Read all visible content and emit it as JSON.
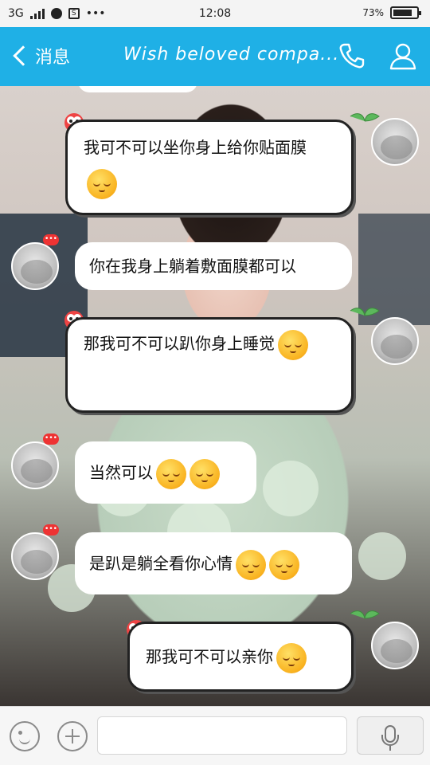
{
  "status_bar": {
    "network": "3G",
    "time": "12:08",
    "battery": "73",
    "overflow": "•••",
    "screen_icon": "S",
    "battery_level": 0.73
  },
  "header": {
    "back_label": "消息",
    "title": "Wish beloved compa...",
    "bar_color": "#1fb0e6",
    "phone_icon": "phone-icon",
    "profile_icon": "user-icon"
  },
  "messages": [
    {
      "side": "right",
      "text": "我可不可以坐你身上给你贴面膜",
      "emoji": 1
    },
    {
      "side": "left",
      "text": "你在我身上躺着敷面膜都可以",
      "emoji": 0
    },
    {
      "side": "right",
      "text": "那我可不可以趴你身上睡觉",
      "emoji": 1
    },
    {
      "side": "left",
      "text": "当然可以",
      "emoji": 2
    },
    {
      "side": "left",
      "text": "是趴是躺全看你心情",
      "emoji": 2
    },
    {
      "side": "right",
      "text": "那我可不可以亲你",
      "emoji": 1
    }
  ],
  "input_bar": {
    "placeholder": "",
    "value": ""
  }
}
